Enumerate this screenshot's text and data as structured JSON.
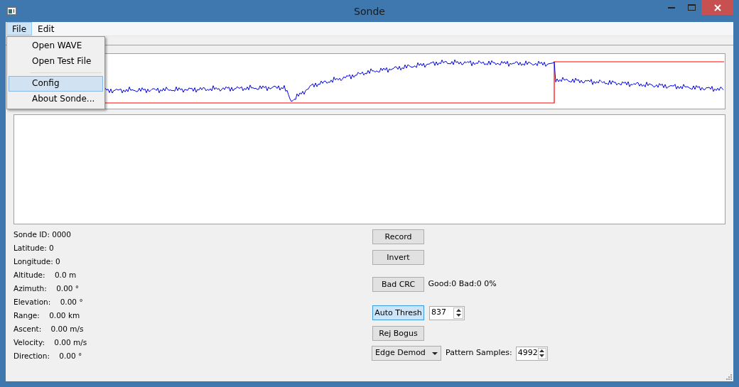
{
  "window": {
    "title": "Sonde"
  },
  "menu_bar": [
    {
      "label": "File",
      "selected": true
    },
    {
      "label": "Edit",
      "selected": false
    }
  ],
  "file_menu": {
    "items": [
      {
        "kind": "item",
        "label": "Open WAVE",
        "selected": false
      },
      {
        "kind": "item",
        "label": "Open Test File",
        "selected": false
      },
      {
        "kind": "separator"
      },
      {
        "kind": "item",
        "label": "Config",
        "selected": true
      },
      {
        "kind": "item",
        "label": "About Sonde...",
        "selected": false
      }
    ]
  },
  "info": [
    "Sonde ID: 0000",
    "Latitude: 0",
    "Longitude: 0",
    "Altitude:    0.0 m",
    "Azimuth:    0.00 °",
    "Elevation:    0.00 °",
    "Range:    0.00 km",
    "Ascent:    0.00 m/s",
    "Velocity:    0.00 m/s",
    "Direction:    0.00 °"
  ],
  "controls": {
    "record": {
      "label": "Record"
    },
    "invert": {
      "label": "Invert"
    },
    "bad_crc": {
      "label": "Bad CRC"
    },
    "crc_status": "Good:0 Bad:0 0%",
    "auto_thresh": {
      "label": "Auto Thresh",
      "checked": true
    },
    "threshold": "837",
    "rej_bogus": {
      "label": "Rej Bogus",
      "checked": false
    },
    "demod": "Edge Demod",
    "pattern_label": "Pattern Samples:",
    "pattern_samples": "4992"
  }
}
